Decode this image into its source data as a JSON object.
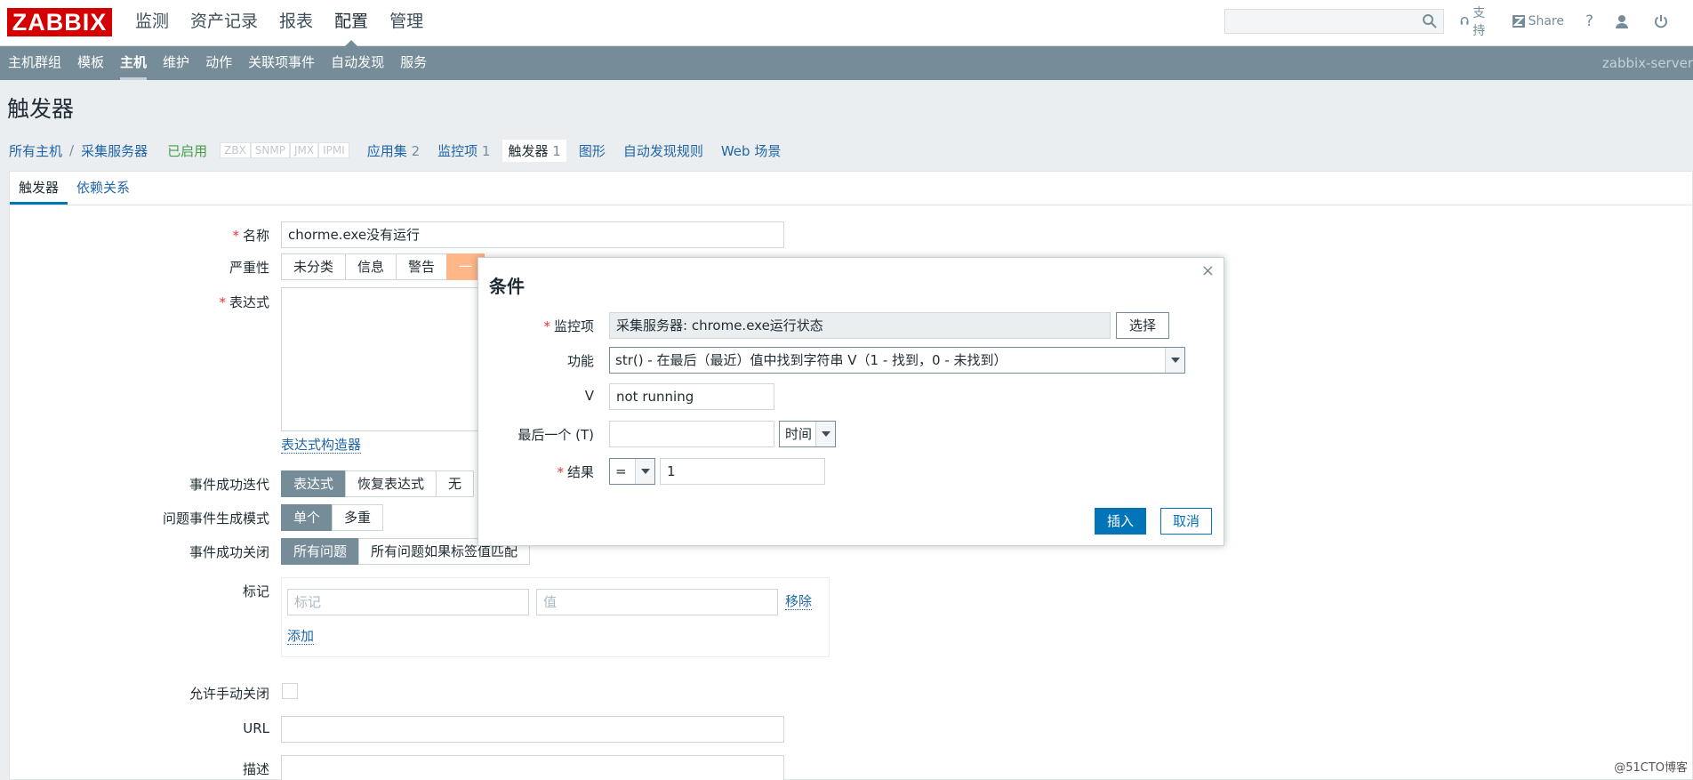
{
  "header": {
    "logo": "ZABBIX",
    "nav": [
      "监测",
      "资产记录",
      "报表",
      "配置",
      "管理"
    ],
    "active_nav": "配置",
    "support": "支持",
    "share": "Share",
    "help": "?"
  },
  "subnav": {
    "items": [
      "主机群组",
      "模板",
      "主机",
      "维护",
      "动作",
      "关联项事件",
      "自动发现",
      "服务"
    ],
    "active": "主机",
    "server": "zabbix-server"
  },
  "page_title": "触发器",
  "breadcrumb": {
    "all_hosts": "所有主机",
    "separator": "/",
    "host": "采集服务器",
    "status": "已启用",
    "badges": [
      "ZBX",
      "SNMP",
      "JMX",
      "IPMI"
    ],
    "tabs": [
      {
        "label": "应用集",
        "count": "2"
      },
      {
        "label": "监控项",
        "count": "1"
      },
      {
        "label": "触发器",
        "count": "1"
      },
      {
        "label": "图形",
        "count": ""
      },
      {
        "label": "自动发现规则",
        "count": ""
      },
      {
        "label": "Web 场景",
        "count": ""
      }
    ]
  },
  "form_tabs": [
    "触发器",
    "依赖关系"
  ],
  "form": {
    "name_label": "名称",
    "name_value": "chorme.exe没有运行",
    "severity_label": "严重性",
    "severity_options": [
      "未分类",
      "信息",
      "警告",
      "一"
    ],
    "expression_label": "表达式",
    "expression_builder": "表达式构造器",
    "ok_event_label": "事件成功迭代",
    "ok_event_options": [
      "表达式",
      "恢复表达式",
      "无"
    ],
    "problem_mode_label": "问题事件生成模式",
    "problem_mode_options": [
      "单个",
      "多重"
    ],
    "ok_close_label": "事件成功关闭",
    "ok_close_options": [
      "所有问题",
      "所有问题如果标签值匹配"
    ],
    "tags_label": "标记",
    "tag_placeholder": "标记",
    "value_placeholder": "值",
    "remove": "移除",
    "add": "添加",
    "manual_close_label": "允许手动关闭",
    "url_label": "URL",
    "desc_label": "描述"
  },
  "modal": {
    "title": "条件",
    "close": "×",
    "item_label": "监控项",
    "item_value": "采集服务器: chrome.exe运行状态",
    "select_button": "选择",
    "function_label": "功能",
    "function_value": "str() - 在最后（最近）值中找到字符串 V（1 - 找到，0 - 未找到）",
    "v_label": "V",
    "v_value": "not running",
    "last_label": "最后一个 (T)",
    "last_value": "",
    "time_unit": "时间",
    "result_label": "结果",
    "result_op": "=",
    "result_value": "1",
    "insert_button": "插入",
    "cancel_button": "取消"
  },
  "watermark": "@51CTO博客"
}
